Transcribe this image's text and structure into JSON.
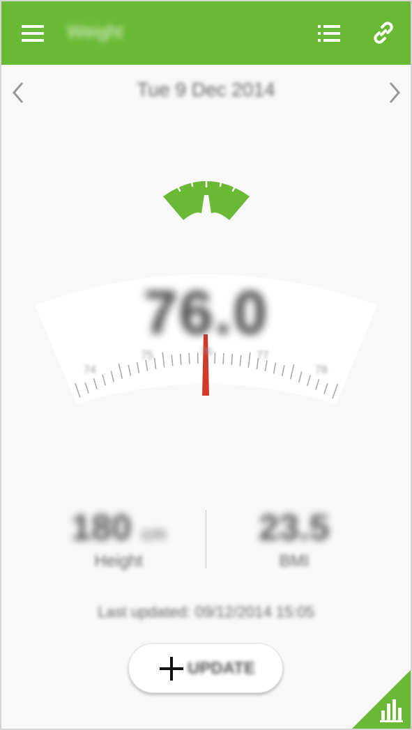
{
  "appbar": {
    "title": "Weight",
    "menu_icon": "hamburger-menu-icon",
    "list_icon": "list-icon",
    "link_icon": "link-icon",
    "color": "#6ab934"
  },
  "date_nav": {
    "date": "Tue 9 Dec 2014",
    "prev_icon": "chevron-left-icon",
    "next_icon": "chevron-right-icon"
  },
  "scale": {
    "weight": "76.0",
    "labels": [
      "74",
      "75",
      "76",
      "77",
      "78"
    ],
    "needle_color": "#d03a2a"
  },
  "stats": {
    "height_value": "180",
    "height_unit": "cm",
    "height_label": "Height",
    "bmi_value": "23.5",
    "bmi_label": "BMI"
  },
  "last_updated": "Last updated: 09/12/2014 15:05",
  "update_button": {
    "label": "UPDATE",
    "icon": "plus-icon"
  },
  "trends_tab": {
    "icon": "bar-chart-icon"
  }
}
